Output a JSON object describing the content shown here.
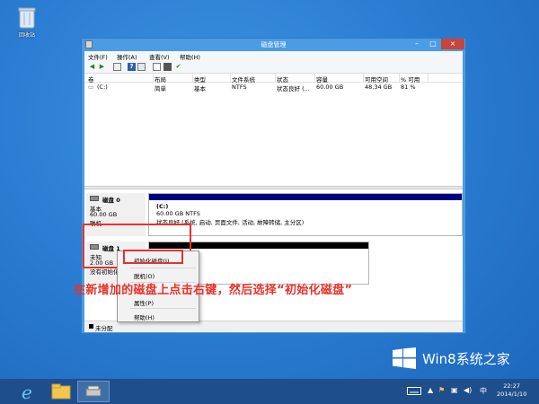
{
  "desktop": {
    "recycle_bin_label": "回收站"
  },
  "window": {
    "title": "磁盘管理",
    "controls": {
      "minimize": "–",
      "maximize": "□",
      "close": "×"
    }
  },
  "menu": [
    "文件(F)",
    "操作(A)",
    "查看(V)",
    "帮助(H)"
  ],
  "toolbar_icons": [
    "back-arrow-icon",
    "forward-arrow-icon",
    "list-icon",
    "help-icon",
    "properties-icon",
    "refresh-icon",
    "disk-icon",
    "checkmark-icon"
  ],
  "volumes": {
    "headers": [
      "卷",
      "布局",
      "类型",
      "文件系统",
      "状态",
      "容量",
      "可用空间",
      "% 可用"
    ],
    "rows": [
      {
        "name": "(C:)",
        "layout": "简单",
        "type": "基本",
        "fs": "NTFS",
        "status": "状态良好 (...",
        "capacity": "60.00 GB",
        "free": "48.34 GB",
        "pct": "81 %"
      }
    ]
  },
  "disks": [
    {
      "name": "磁盘 0",
      "type": "基本",
      "size": "60.00 GB",
      "state": "联机",
      "partition": {
        "label": "(C:)",
        "size": "60.00 GB NTFS",
        "status": "状态良好 (系统, 启动, 页面文件, 活动, 故障转储, 主分区)"
      }
    },
    {
      "name": "磁盘 1",
      "type": "未知",
      "size": "2.00 GB",
      "state": "没有初始化"
    }
  ],
  "legend": {
    "label": "未分配"
  },
  "context_menu": {
    "items": [
      "初始化磁盘(I)",
      "脱机(O)",
      "属性(P)",
      "帮助(H)"
    ]
  },
  "annotation": "在新增加的磁盘上点击右键，然后选择“初始化磁盘”",
  "watermark": {
    "text": "Win8系统之家"
  },
  "taskbar": {
    "clock_time": "22:27",
    "clock_date": "2014/1/10"
  },
  "colors": {
    "desktop": "#2b7ed3",
    "title_bar": "#4c9ce4",
    "close_button": "#c9443a",
    "partition_bar": "#00007f",
    "unallocated_bar": "#000000",
    "annotation": "#e8322b",
    "taskbar": "#1e4f8c"
  }
}
